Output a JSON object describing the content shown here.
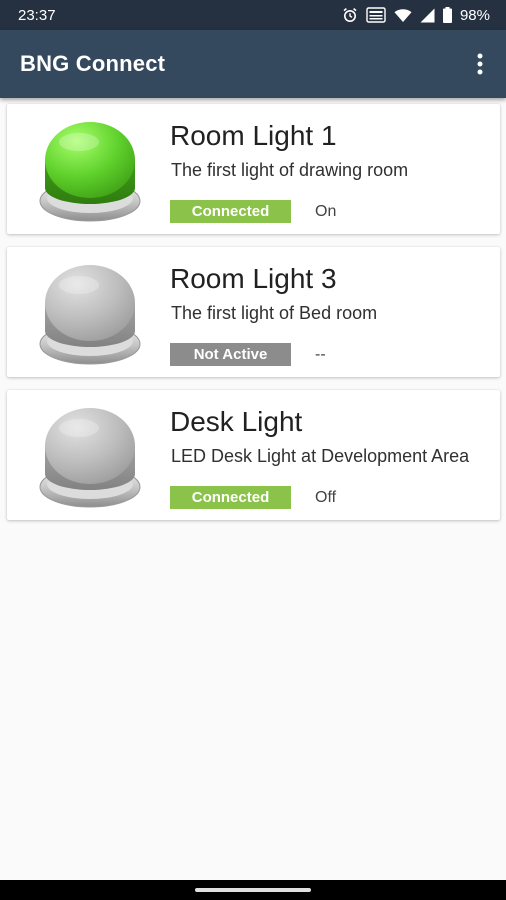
{
  "status_bar": {
    "time": "23:37",
    "battery": "98%",
    "icons": [
      "alarm-icon",
      "volte-icon",
      "wifi-icon",
      "signal-icon",
      "battery-icon"
    ]
  },
  "app_bar": {
    "title": "BNG Connect",
    "menu_icon": "more-vert-icon"
  },
  "devices": [
    {
      "title": "Room Light 1",
      "description": "The first light of drawing room",
      "status": "Connected",
      "state": "On",
      "button_color": "green"
    },
    {
      "title": "Room Light 3",
      "description": "The first light of Bed room",
      "status": "Not Active",
      "state": "--",
      "button_color": "gray"
    },
    {
      "title": "Desk Light",
      "description": "LED Desk Light at Development Area",
      "status": "Connected",
      "state": "Off",
      "button_color": "gray"
    }
  ],
  "colors": {
    "status_bar": "#253140",
    "app_bar": "#34495e",
    "connected_badge": "#8bc34a",
    "not_active_badge": "#8c8c8c",
    "on_button": "#5fd12c",
    "off_button": "#b5b5b5",
    "background": "#fafafa"
  }
}
